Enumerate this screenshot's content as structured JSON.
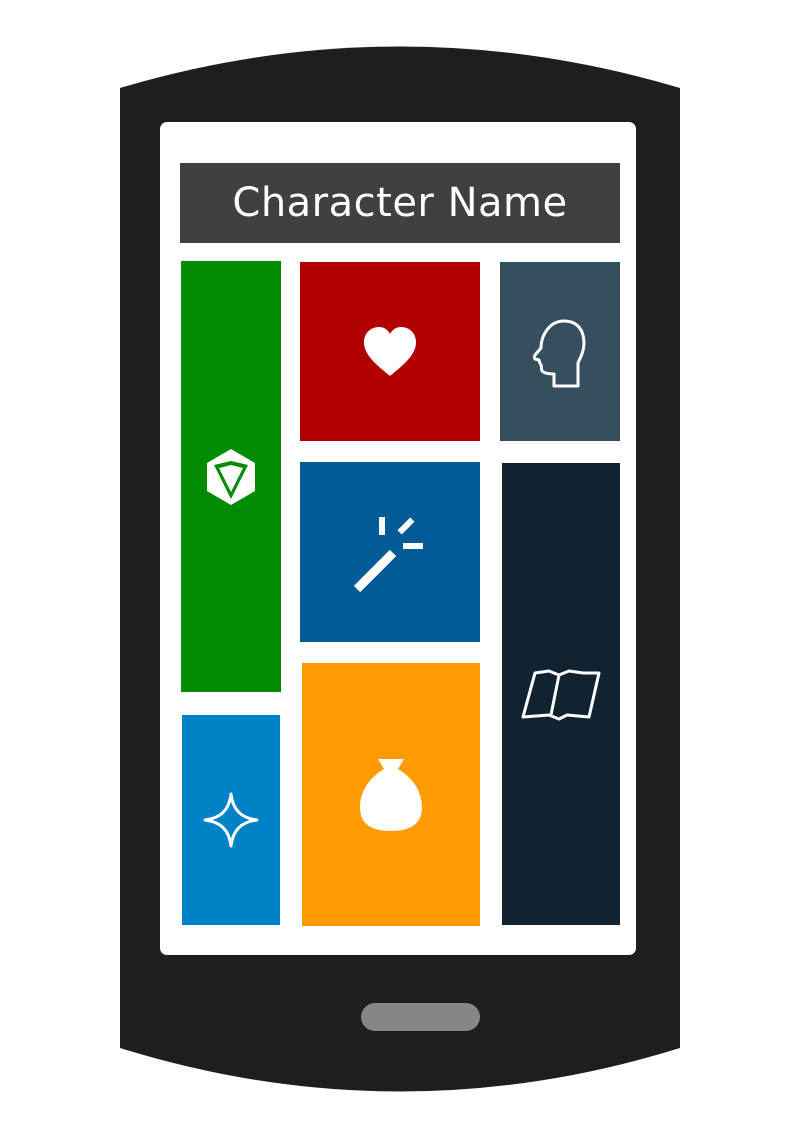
{
  "app": {
    "title": "Character Name"
  },
  "tiles": [
    {
      "id": "dice",
      "icon": "d20-dice-icon",
      "color": "#008b00"
    },
    {
      "id": "health",
      "icon": "heart-icon",
      "color": "#b00000"
    },
    {
      "id": "profile",
      "icon": "head-profile-icon",
      "color": "#364f5f"
    },
    {
      "id": "spells",
      "icon": "magic-wand-icon",
      "color": "#005b96"
    },
    {
      "id": "journal",
      "icon": "open-book-icon",
      "color": "#112330"
    },
    {
      "id": "skills",
      "icon": "sparkle-star-icon",
      "color": "#0083c6"
    },
    {
      "id": "inventory",
      "icon": "money-bag-icon",
      "color": "#ff9b00"
    }
  ],
  "colors": {
    "phone_body": "#1e1e1e",
    "title_bar": "#404040",
    "home_button": "#868686"
  }
}
